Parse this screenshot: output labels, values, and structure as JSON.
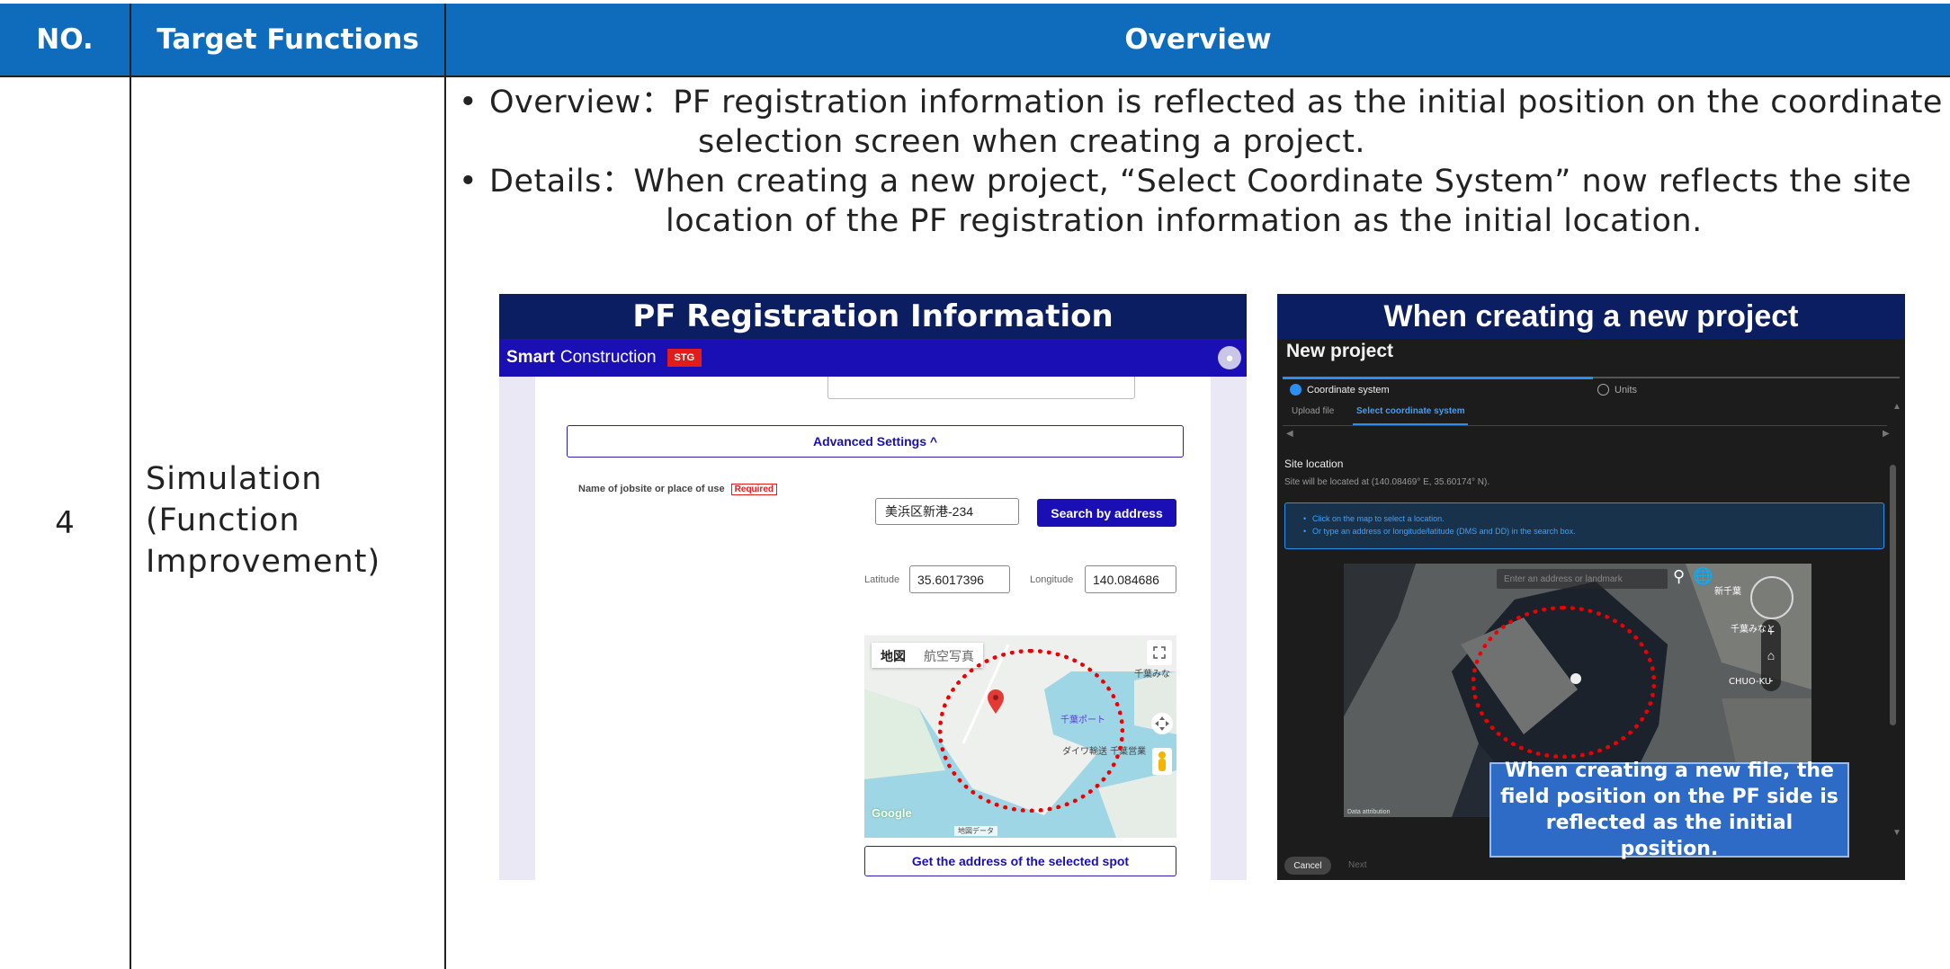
{
  "table": {
    "headers": {
      "no": "NO.",
      "target": "Target Functions",
      "overview": "Overview"
    },
    "row": {
      "no": "4",
      "target_lines": [
        "Simulation",
        "(Function",
        "Improvement)"
      ],
      "bullets": [
        {
          "marker": "•",
          "first": "Overview：PF registration information is reflected as the initial position on the coordinate",
          "cont": "selection screen when creating a project."
        },
        {
          "marker": "•",
          "first": "Details：When creating a new project, “Select Coordinate System” now reflects the site",
          "cont": "location of the PF registration information as the initial location."
        }
      ]
    }
  },
  "pf_panel": {
    "title": "PF Registration Information",
    "brand_bold": "Smart",
    "brand_rest": "Construction",
    "env_badge": "STG",
    "advanced_settings": "Advanced Settings  ^",
    "jobsite_label": "Name of jobsite or place of use",
    "required_tag": "Required",
    "address_value": "美浜区新港-234",
    "search_button": "Search by address",
    "latitude_label": "Latitude",
    "latitude_value": "35.6017396",
    "longitude_label": "Longitude",
    "longitude_value": "140.084686",
    "map_tab_map": "地図",
    "map_tab_aerial": "航空写真",
    "map_place_1": "千葉みな",
    "map_place_2": "千葉ポート",
    "map_place_3": "ダイワ輸送 千葉営業",
    "map_google": "Google",
    "map_footer": "地図データ",
    "get_address_button": "Get the address of the selected spot",
    "colors": {
      "bar": "#1a0fb4",
      "badge": "#e21b1b",
      "title_bg": "#0b1e62"
    }
  },
  "new_project_panel": {
    "title": "When creating a new project",
    "heading": "New project",
    "step_1": "Coordinate system",
    "step_2": "Units",
    "tab_upload": "Upload file",
    "tab_select": "Select coordinate system",
    "site_location": "Site location",
    "site_location_value": "Site will be located at (140.08469° E, 35.60174° N).",
    "info_lines": [
      "Click on the map to select a location.",
      "Or type an address or longitude/latitude (DMS and DD) in the search box."
    ],
    "search_placeholder": "Enter an address or landmark",
    "map_place_1": "新千葉",
    "map_place_2": "千葉みなと",
    "map_place_3": "CHUO-KU",
    "map_attribution": "Data attribution",
    "cancel": "Cancel",
    "next": "Next",
    "colors": {
      "accent": "#2c8ff0",
      "background": "#1c1c1c"
    }
  },
  "callout": "When creating a new file, the field position on the PF side is reflected as the initial position.",
  "colors": {
    "header_bg": "#0f6cbd",
    "highlight_circle": "#e00000",
    "callout_bg": "#2e6bc6"
  }
}
